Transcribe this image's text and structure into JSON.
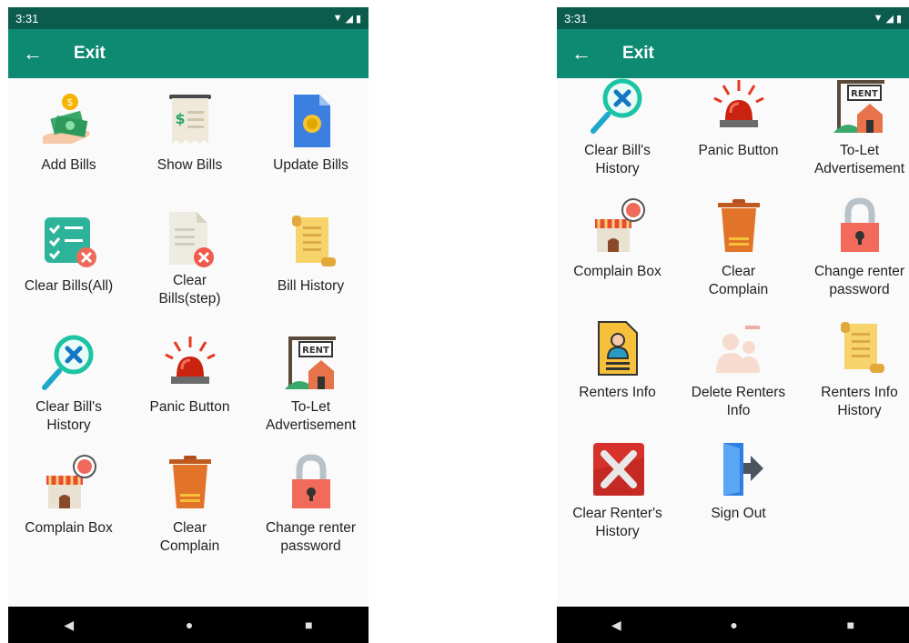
{
  "left": {
    "status_time": "3:31",
    "title": "Exit",
    "items": [
      {
        "label": "Add Bills",
        "icon": "money-hand-icon"
      },
      {
        "label": "Show Bills",
        "icon": "receipt-icon"
      },
      {
        "label": "Update Bills",
        "icon": "document-coin-icon"
      },
      {
        "label": "Clear Bills(All)",
        "icon": "checklist-remove-icon"
      },
      {
        "label": "Clear\nBills(step)",
        "icon": "document-remove-icon"
      },
      {
        "label": "Bill History",
        "icon": "scroll-icon"
      },
      {
        "label": "Clear Bill's\nHistory",
        "icon": "search-clear-icon"
      },
      {
        "label": "Panic Button",
        "icon": "alarm-siren-icon"
      },
      {
        "label": "To-Let\nAdvertisement",
        "icon": "rent-sign-icon"
      },
      {
        "label": "Complain Box",
        "icon": "shop-complain-icon"
      },
      {
        "label": "Clear\nComplain",
        "icon": "trash-bin-icon"
      },
      {
        "label": "Change renter\npassword",
        "icon": "padlock-icon"
      }
    ]
  },
  "right": {
    "status_time": "3:31",
    "title": "Exit",
    "items": [
      {
        "label": "Clear Bill's\nHistory",
        "icon": "search-clear-icon"
      },
      {
        "label": "Panic Button",
        "icon": "alarm-siren-icon"
      },
      {
        "label": "To-Let\nAdvertisement",
        "icon": "rent-sign-icon"
      },
      {
        "label": "Complain Box",
        "icon": "shop-complain-icon"
      },
      {
        "label": "Clear\nComplain",
        "icon": "trash-bin-icon"
      },
      {
        "label": "Change renter\npassword",
        "icon": "padlock-icon"
      },
      {
        "label": "Renters Info",
        "icon": "id-document-icon"
      },
      {
        "label": "Delete Renters\nInfo",
        "icon": "people-delete-icon"
      },
      {
        "label": "Renters Info\nHistory",
        "icon": "scroll-icon"
      },
      {
        "label": "Clear Renter's\nHistory",
        "icon": "red-x-icon"
      },
      {
        "label": "Sign Out",
        "icon": "sign-out-door-icon"
      }
    ]
  },
  "colors": {
    "status_bar": "#0c5c4e",
    "app_bar": "#0f8a72",
    "background": "#fafafa",
    "nav_bar": "#000000"
  }
}
